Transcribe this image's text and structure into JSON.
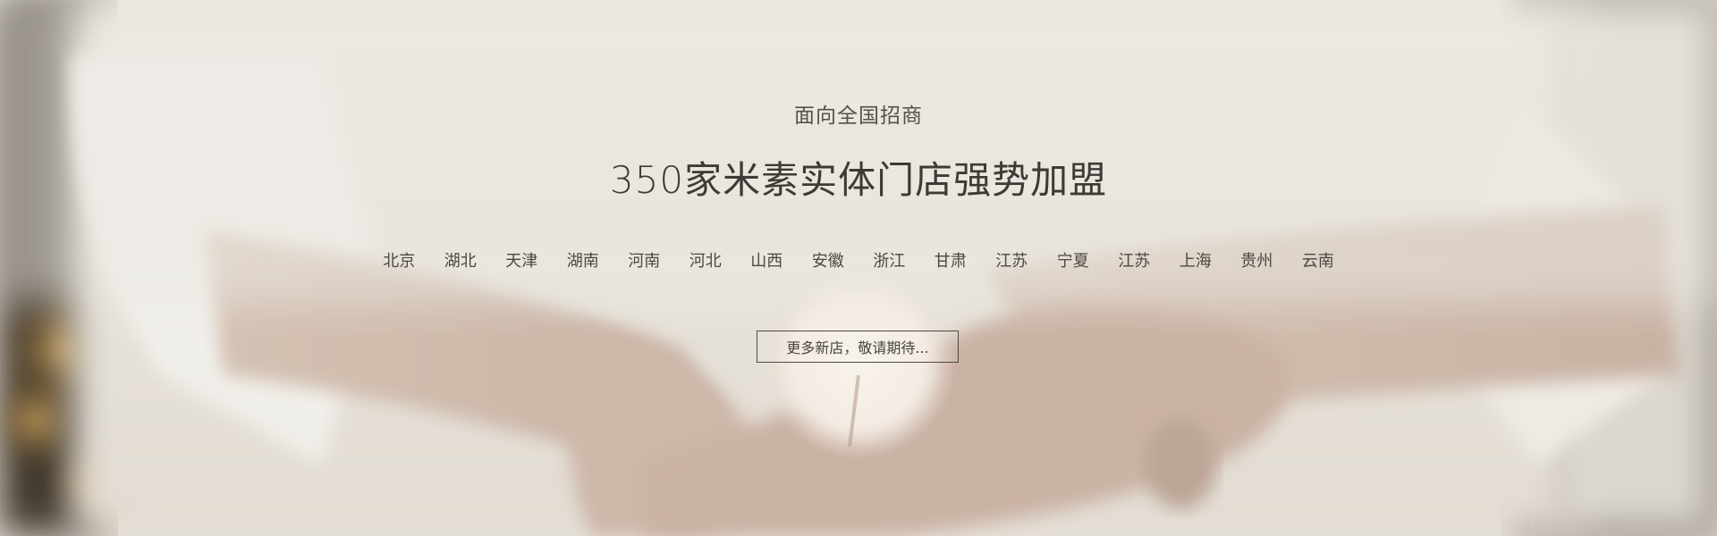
{
  "hero": {
    "subtitle": "面向全国招商",
    "title": "350家米素实体门店强势加盟",
    "regions": [
      "北京",
      "湖北",
      "天津",
      "湖南",
      "河南",
      "河北",
      "山西",
      "安徽",
      "浙江",
      "甘肃",
      "江苏",
      "宁夏",
      "江苏",
      "上海",
      "贵州",
      "云南"
    ],
    "more_button": "更多新店，敬请期待..."
  },
  "colors": {
    "text_dark": "#3f3a35",
    "text_medium": "#555049",
    "background_tone": "#e6e0d6"
  },
  "icons": {
    "background_image": "dandelion-in-hands-photo"
  }
}
